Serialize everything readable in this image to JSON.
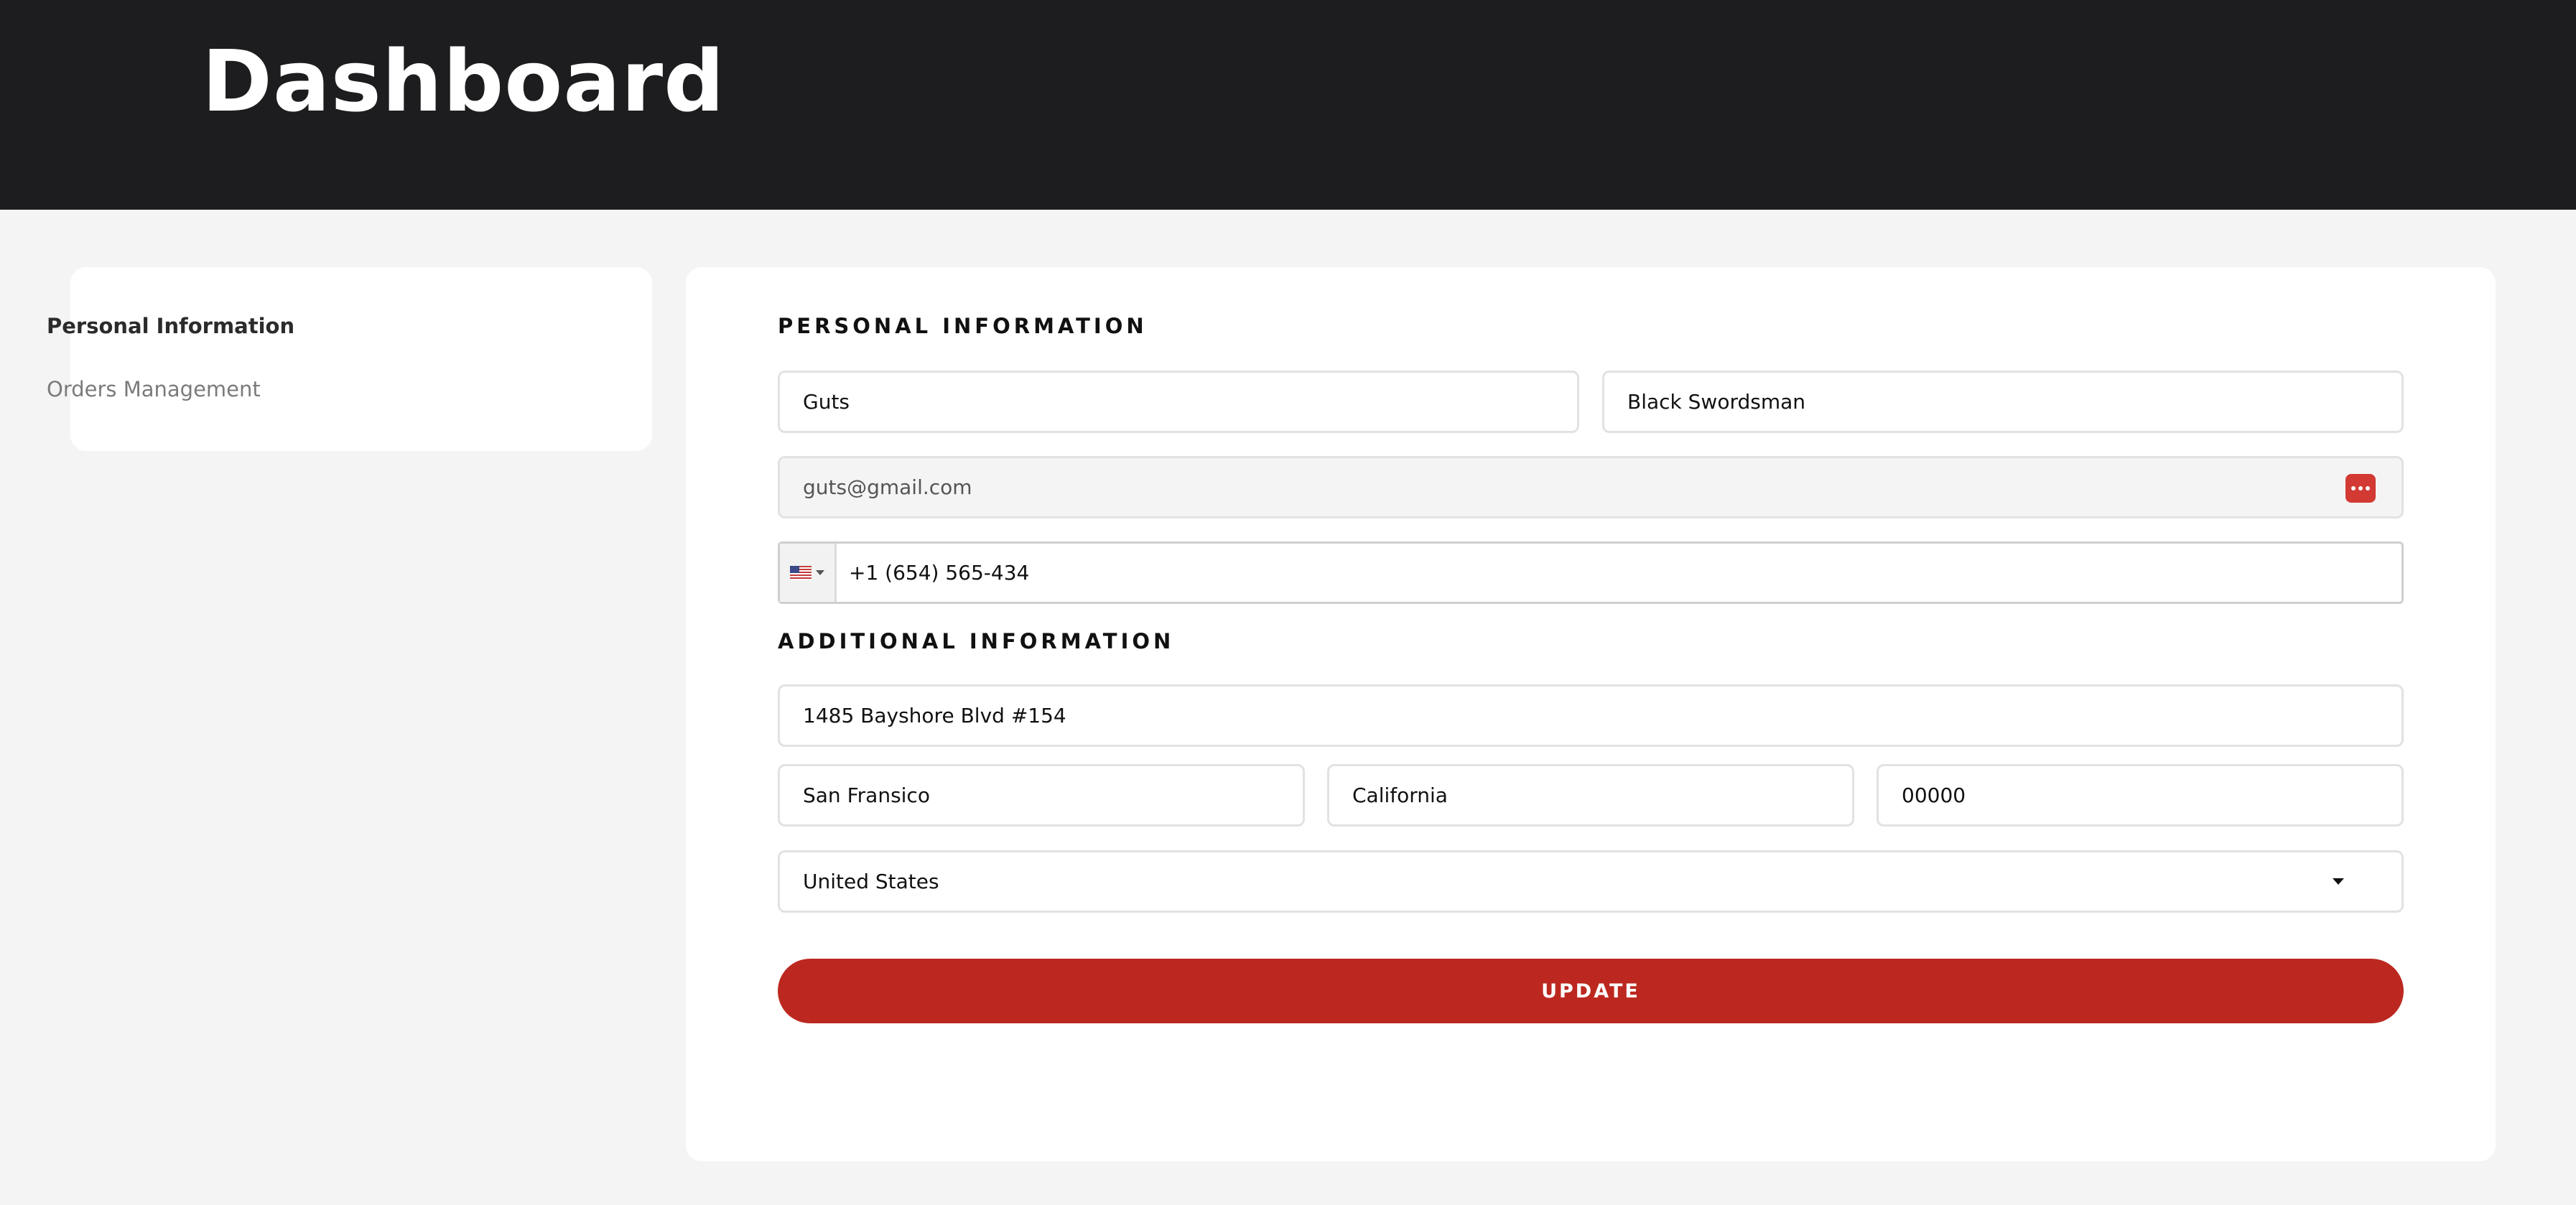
{
  "header": {
    "title": "Dashboard"
  },
  "sidebar": {
    "items": [
      {
        "label": "Personal Information",
        "active": true
      },
      {
        "label": "Orders Management",
        "active": false
      }
    ]
  },
  "form": {
    "personal_section_title": "PERSONAL INFORMATION",
    "first_name": "Guts",
    "last_name": "Black Swordsman",
    "email": "guts@gmail.com",
    "password_manager_icon": "password-dots-icon",
    "phone": {
      "country_flag": "us-flag-icon",
      "number": "+1 (654) 565-434"
    },
    "additional_section_title": "ADDITIONAL INFORMATION",
    "address": "1485 Bayshore Blvd #154",
    "city": "San Fransico",
    "state": "California",
    "zip": "00000",
    "country": "United States",
    "update_label": "UPDATE"
  },
  "colors": {
    "header_bg": "#1d1d1f",
    "page_bg": "#f4f4f4",
    "accent": "#bc2820",
    "icon_red": "#d23a33"
  }
}
